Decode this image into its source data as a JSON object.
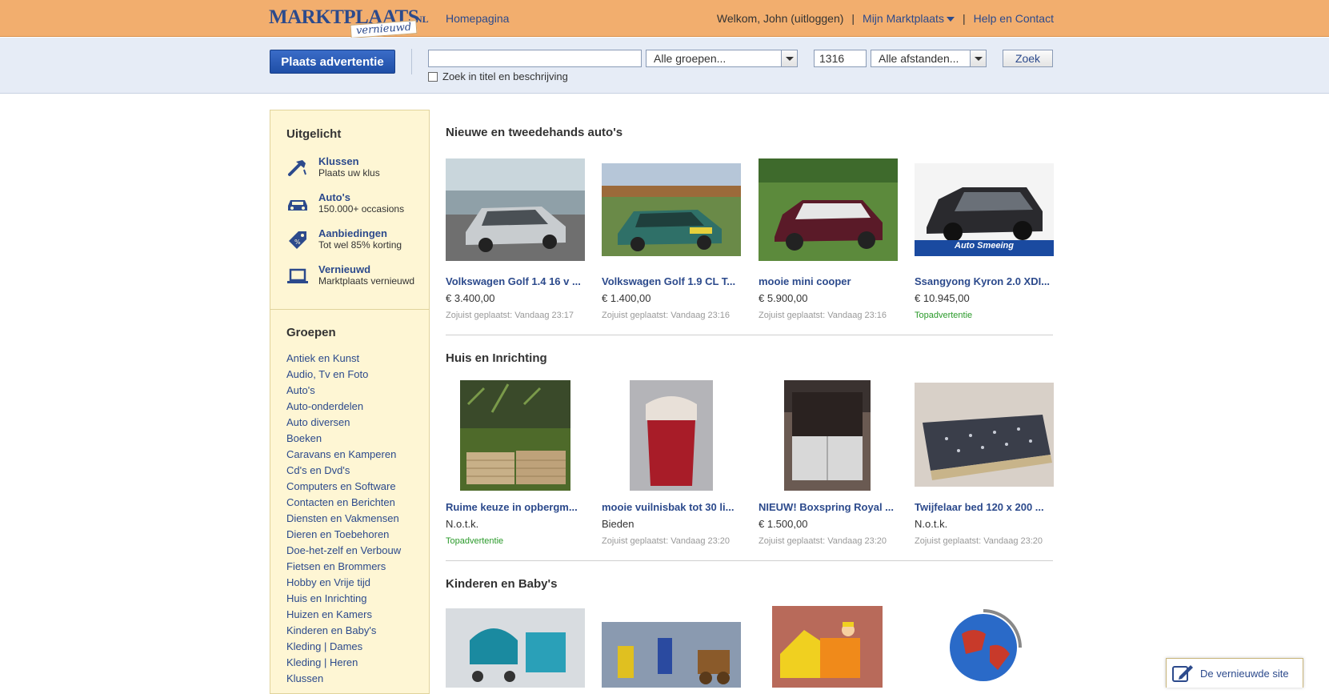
{
  "header": {
    "logo_main": "MARKTPLAATS",
    "logo_nl": "NL",
    "logo_sub": "vernieuwd",
    "home_link": "Homepagina",
    "welcome": "Welkom, John (uitloggen)",
    "sep": "|",
    "my_marktplaats": "Mijn Marktplaats",
    "help": "Help en Contact"
  },
  "search": {
    "place_ad": "Plaats advertentie",
    "query": "",
    "group_select": "Alle groepen...",
    "zip": "1316",
    "distance_select": "Alle afstanden...",
    "search_button": "Zoek",
    "title_desc_checkbox": "Zoek in titel en beschrijving"
  },
  "sidebar": {
    "featured_heading": "Uitgelicht",
    "featured": [
      {
        "title": "Klussen",
        "sub": "Plaats uw klus",
        "icon": "hammer-icon"
      },
      {
        "title": "Auto's",
        "sub": "150.000+ occasions",
        "icon": "car-icon"
      },
      {
        "title": "Aanbiedingen",
        "sub": "Tot wel 85% korting",
        "icon": "price-tag-icon"
      },
      {
        "title": "Vernieuwd",
        "sub": "Marktplaats vernieuwd",
        "icon": "laptop-icon"
      }
    ],
    "groups_heading": "Groepen",
    "groups": [
      "Antiek en Kunst",
      "Audio, Tv en Foto",
      "Auto's",
      "Auto-onderdelen",
      "Auto diversen",
      "Boeken",
      "Caravans en Kamperen",
      "Cd's en Dvd's",
      "Computers en Software",
      "Contacten en Berichten",
      "Diensten en Vakmensen",
      "Dieren en Toebehoren",
      "Doe-het-zelf en Verbouw",
      "Fietsen en Brommers",
      "Hobby en Vrije tijd",
      "Huis en Inrichting",
      "Huizen en Kamers",
      "Kinderen en Baby's",
      "Kleding | Dames",
      "Kleding | Heren",
      "Klussen"
    ]
  },
  "sections": [
    {
      "heading": "Nieuwe en tweedehands auto's",
      "items": [
        {
          "title": "Volkswagen Golf 1.4 16 v ...",
          "price": "€ 3.400,00",
          "meta": "Zojuist geplaatst: Vandaag 23:17"
        },
        {
          "title": "Volkswagen Golf 1.9 CL T...",
          "price": "€ 1.400,00",
          "meta": "Zojuist geplaatst: Vandaag 23:16"
        },
        {
          "title": "mooie mini cooper",
          "price": "€ 5.900,00",
          "meta": "Zojuist geplaatst: Vandaag 23:16"
        },
        {
          "title": "Ssangyong Kyron 2.0 XDI...",
          "price": "€ 10.945,00",
          "meta": "Topadvertentie",
          "ad_badge": "Auto Smeeing"
        }
      ]
    },
    {
      "heading": "Huis en Inrichting",
      "items": [
        {
          "title": "Ruime keuze in opbergm...",
          "price": "N.o.t.k.",
          "meta": "Topadvertentie"
        },
        {
          "title": "mooie vuilnisbak tot 30 li...",
          "price": "Bieden",
          "meta": "Zojuist geplaatst: Vandaag 23:20"
        },
        {
          "title": "NIEUW! Boxspring Royal ...",
          "price": "€ 1.500,00",
          "meta": "Zojuist geplaatst: Vandaag 23:20"
        },
        {
          "title": "Twijfelaar bed 120 x 200 ...",
          "price": "N.o.t.k.",
          "meta": "Zojuist geplaatst: Vandaag 23:20"
        }
      ]
    },
    {
      "heading": "Kinderen en Baby's",
      "items": []
    }
  ],
  "feedback": {
    "label": "De vernieuwde site",
    "icon": "feedback-pen-icon"
  },
  "colors": {
    "header_bg": "#f2ae6e",
    "search_bg": "#e6ecf6",
    "sidebar_bg": "#fef6d4",
    "link": "#2c4a8c",
    "top_ad": "#2a9a2a"
  }
}
